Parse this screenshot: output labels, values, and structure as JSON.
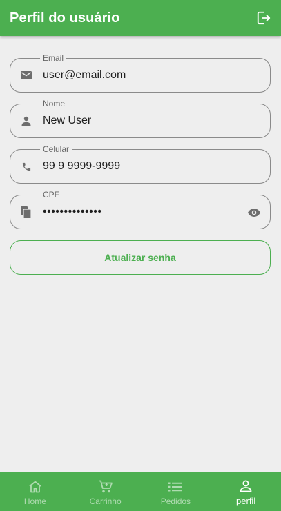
{
  "header": {
    "title": "Perfil do usuário",
    "logout_icon": "logout-icon"
  },
  "form": {
    "email": {
      "label": "Email",
      "value": "user@email.com",
      "icon": "mail-icon"
    },
    "nome": {
      "label": "Nome",
      "value": "New User",
      "icon": "person-icon"
    },
    "celular": {
      "label": "Celular",
      "value": "99 9 9999-9999",
      "icon": "phone-icon"
    },
    "cpf": {
      "label": "CPF",
      "value": "••••••••••••••",
      "icon": "copy-icon",
      "visibility_icon": "eye-icon"
    },
    "update_password_label": "Atualizar senha"
  },
  "bottom_nav": {
    "items": [
      {
        "label": "Home",
        "icon": "home-icon",
        "active": false
      },
      {
        "label": "Carrinho",
        "icon": "cart-icon",
        "active": false
      },
      {
        "label": "Pedidos",
        "icon": "list-icon",
        "active": false
      },
      {
        "label": "perfil",
        "icon": "person-outline-icon",
        "active": true
      }
    ]
  },
  "colors": {
    "primary": "#4caf50",
    "background": "#eeeeee",
    "border": "#8a8a8a",
    "icon": "#6d6d6d"
  }
}
